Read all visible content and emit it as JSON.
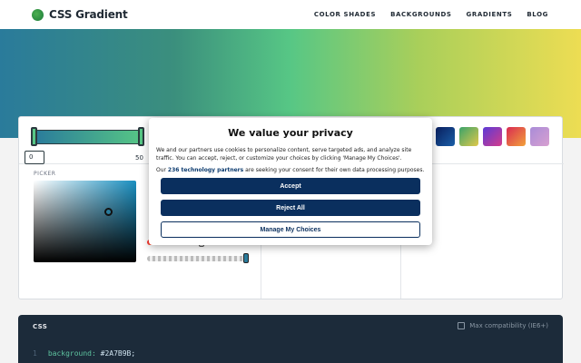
{
  "header": {
    "logo_text": "CSS Gradient",
    "nav": [
      "COLOR SHADES",
      "BACKGROUNDS",
      "GRADIENTS",
      "BLOG"
    ]
  },
  "colors": {
    "gradient_start": "#2A7B9B",
    "gradient_mid": "#57C785",
    "gradient_end": "#EDDD53",
    "dialog_button": "#0a2f5e",
    "code_bg": "#1c2b3a"
  },
  "editor": {
    "stop_value": "0",
    "stop_label": "50",
    "picker_label": "PICKER"
  },
  "code_panel": {
    "title": "CSS",
    "compat_label": "Max compatibility (IE6+)",
    "line_number": "1",
    "property": "background:",
    "value": " #2A7B9B;"
  },
  "consent": {
    "title": "We value your privacy",
    "body": "We and our partners use cookies to personalize content, serve targeted ads, and analyze site traffic. You can accept, reject, or customize your choices by clicking 'Manage My Choices'.",
    "partners_prefix": "Our ",
    "partners_link": "236 technology partners",
    "partners_suffix": " are seeking your consent for their own data processing purposes.",
    "accept": "Accept",
    "reject": "Reject All",
    "manage": "Manage My Choices"
  }
}
